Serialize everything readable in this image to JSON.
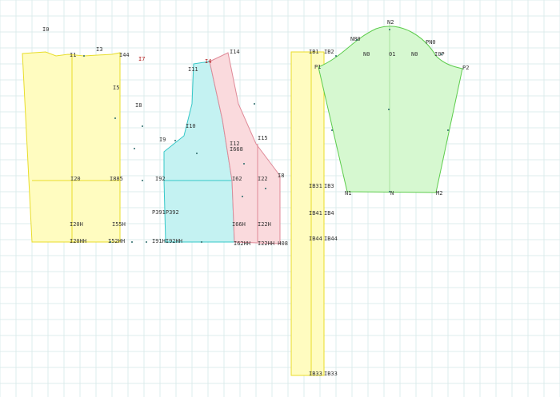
{
  "colors": {
    "grid": "#dcecec",
    "yellow_fill": "#fffcc0",
    "yellow_stroke": "#e8dd2a",
    "cyan_fill": "#c4f2f2",
    "cyan_stroke": "#36c8c8",
    "pink_fill": "#fadadd",
    "pink_stroke": "#e08a98",
    "green_fill": "#d6f8d0",
    "green_stroke": "#5ccc4c",
    "label": "#333333",
    "label_red": "#b01818"
  },
  "labels": {
    "l_i0": "I0",
    "l_i1": "I1",
    "l_i3": "I3",
    "l_i44": "I44",
    "l_i7": "I7",
    "l_i5": "I5",
    "l_i8": "I8",
    "l_i20": "I20",
    "l_i885": "I885",
    "l_i20h": "I20H",
    "l_i55h": "I55H",
    "l_i20hh": "I20HH",
    "l_i52hh": "I52HH",
    "l_i4": "I4",
    "l_i11": "I11",
    "l_i10": "I10",
    "l_i9": "I9",
    "l_i92": "I92",
    "l_p391p392": "P391P392",
    "l_i91h92hh": "I91HI92HH",
    "l_i14": "I14",
    "l_i12": "I12",
    "l_i668": "I668",
    "l_i15": "I15",
    "l_i62": "I62",
    "l_i22": "I22",
    "l_i8b": "I8",
    "l_i66h": "I66H",
    "l_i22h": "I22H",
    "l_i62hh": "I62HH",
    "l_i22hh": "I22HH H08",
    "l_ib1": "IB1",
    "l_ib2": "IB2",
    "l_ib31": "IB31",
    "l_ib3": "IB3",
    "l_ib41": "IB41",
    "l_ib4": "IB4",
    "l_ib44": "IB44",
    "l_ib444": "IB44",
    "l_ib33": "IB33",
    "l_ib333": "IB33",
    "l_n2": "N2",
    "l_n80": "N80",
    "l_n0": "N0",
    "l_01": "01",
    "l_pn0": "PN0",
    "l_p2": "P2",
    "l_i0p": "I0P",
    "l_n1": "N1",
    "l_nm": "N",
    "l_m2": "M2",
    "l_nl": "N1",
    "l_p1": "P1",
    "l_n0b": "N0"
  }
}
